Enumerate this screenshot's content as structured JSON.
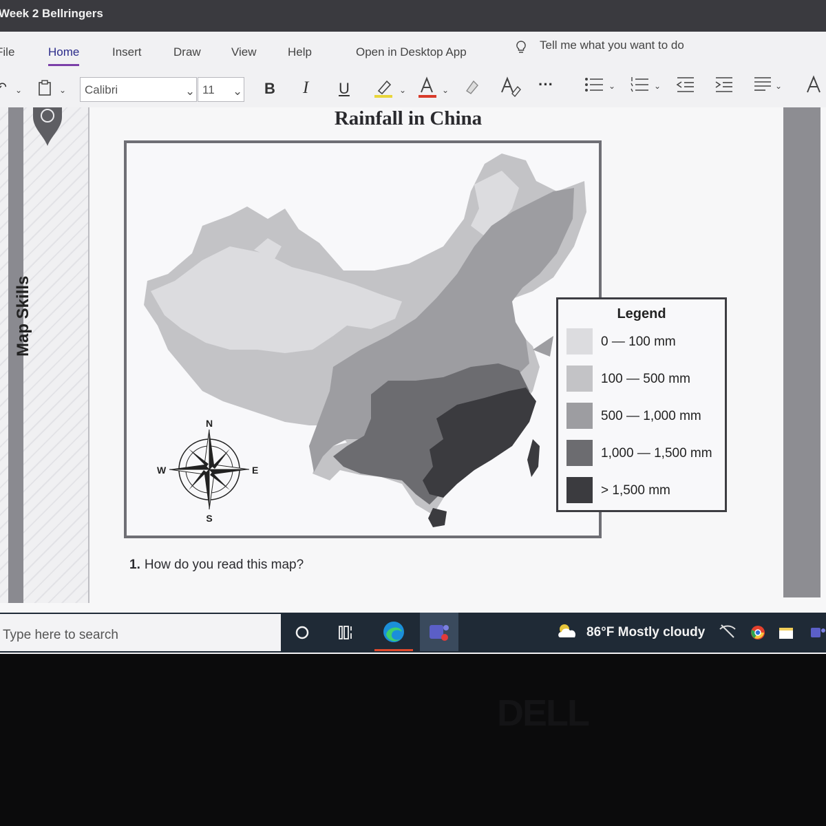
{
  "window": {
    "title": "Week 2 Bellringers"
  },
  "ribbon": {
    "tabs": [
      "File",
      "Home",
      "Insert",
      "Draw",
      "View",
      "Help"
    ],
    "open_desktop": "Open in Desktop App",
    "tell_me": "Tell me what you want to do",
    "font_name": "Calibri",
    "font_size": "11",
    "bold": "B",
    "italic": "I",
    "underline": "U",
    "more": "···"
  },
  "document": {
    "side_label": "Map Skills",
    "title": "Rainfall in China",
    "compass": {
      "n": "N",
      "s": "S",
      "e": "E",
      "w": "W"
    },
    "legend": {
      "title": "Legend",
      "items": [
        {
          "label": "0 — 100 mm",
          "color": "#dcdcdf"
        },
        {
          "label": "100 — 500 mm",
          "color": "#c3c3c6"
        },
        {
          "label": "500 — 1,000 mm",
          "color": "#9d9da1"
        },
        {
          "label": "1,000 — 1,500 mm",
          "color": "#6c6c70"
        },
        {
          "label": "> 1,500 mm",
          "color": "#3b3b3f"
        }
      ]
    },
    "question_number": "1.",
    "question_text": "How do you read this map?"
  },
  "taskbar": {
    "search_placeholder": "Type here to search",
    "weather": "86°F  Mostly cloudy"
  },
  "bezel": {
    "brand": "DELL"
  }
}
